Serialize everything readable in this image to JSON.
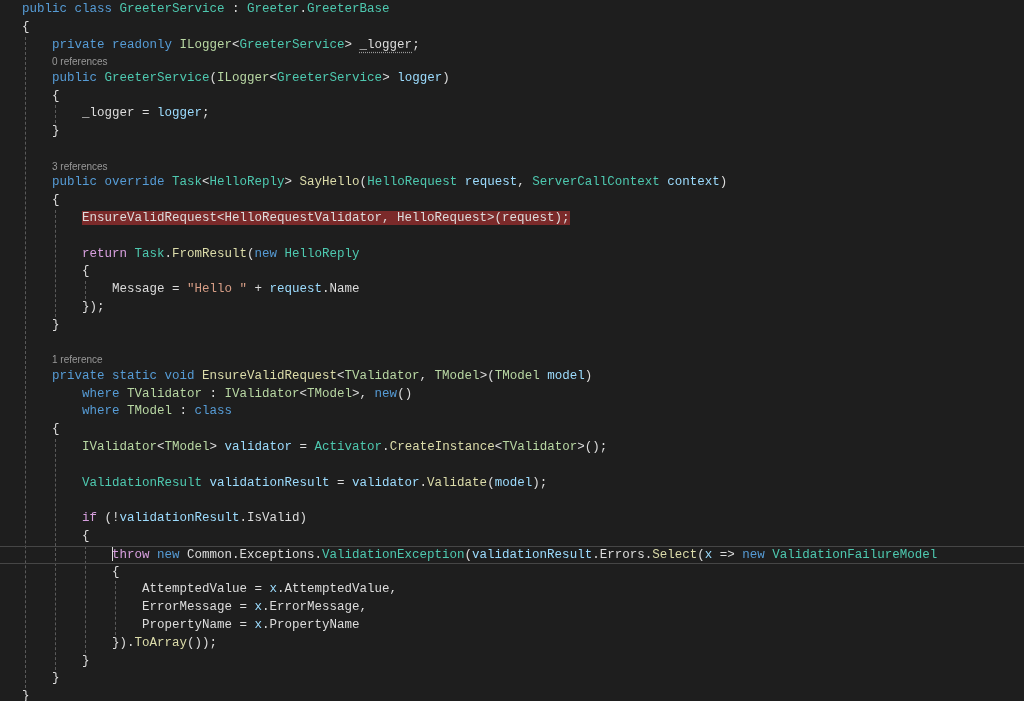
{
  "editor": {
    "lines": [
      {
        "kind": "code",
        "tokens": [
          {
            "text": "public class ",
            "kind": "kw"
          },
          {
            "text": "GreeterService",
            "kind": "type"
          },
          {
            "text": " : ",
            "kind": "plain"
          },
          {
            "text": "Greeter",
            "kind": "type"
          },
          {
            "text": ".",
            "kind": "plain"
          },
          {
            "text": "GreeterBase",
            "kind": "type"
          }
        ]
      },
      {
        "kind": "code",
        "tokens": [
          {
            "text": "{",
            "kind": "plain"
          }
        ],
        "guide": true,
        "children": [
          {
            "kind": "code",
            "tokens": [
              {
                "text": "private readonly ",
                "kind": "kw"
              },
              {
                "text": "ILogger",
                "kind": "iface"
              },
              {
                "text": "<",
                "kind": "plain"
              },
              {
                "text": "GreeterService",
                "kind": "type"
              },
              {
                "text": "> ",
                "kind": "plain"
              },
              {
                "text": "_logger",
                "kind": "hint"
              },
              {
                "text": ";",
                "kind": "plain"
              }
            ]
          },
          {
            "kind": "codelens",
            "text": "0 references"
          },
          {
            "kind": "code",
            "tokens": [
              {
                "text": "public ",
                "kind": "kw"
              },
              {
                "text": "GreeterService",
                "kind": "type"
              },
              {
                "text": "(",
                "kind": "plain"
              },
              {
                "text": "ILogger",
                "kind": "iface"
              },
              {
                "text": "<",
                "kind": "plain"
              },
              {
                "text": "GreeterService",
                "kind": "type"
              },
              {
                "text": "> ",
                "kind": "plain"
              },
              {
                "text": "logger",
                "kind": "var"
              },
              {
                "text": ")",
                "kind": "plain"
              }
            ]
          },
          {
            "kind": "code",
            "tokens": [
              {
                "text": "{",
                "kind": "plain"
              }
            ],
            "guide": true,
            "children": [
              {
                "kind": "code",
                "tokens": [
                  {
                    "text": "_logger = ",
                    "kind": "plain"
                  },
                  {
                    "text": "logger",
                    "kind": "var"
                  },
                  {
                    "text": ";",
                    "kind": "plain"
                  }
                ]
              }
            ]
          },
          {
            "kind": "code",
            "tokens": [
              {
                "text": "}",
                "kind": "plain"
              }
            ]
          },
          {
            "kind": "blank"
          },
          {
            "kind": "codelens",
            "text": "3 references"
          },
          {
            "kind": "code",
            "tokens": [
              {
                "text": "public override ",
                "kind": "kw"
              },
              {
                "text": "Task",
                "kind": "type"
              },
              {
                "text": "<",
                "kind": "plain"
              },
              {
                "text": "HelloReply",
                "kind": "type"
              },
              {
                "text": "> ",
                "kind": "plain"
              },
              {
                "text": "SayHello",
                "kind": "method"
              },
              {
                "text": "(",
                "kind": "plain"
              },
              {
                "text": "HelloRequest ",
                "kind": "type"
              },
              {
                "text": "request",
                "kind": "var"
              },
              {
                "text": ", ",
                "kind": "plain"
              },
              {
                "text": "ServerCallContext ",
                "kind": "type"
              },
              {
                "text": "context",
                "kind": "var"
              },
              {
                "text": ")",
                "kind": "plain"
              }
            ]
          },
          {
            "kind": "code",
            "tokens": [
              {
                "text": "{",
                "kind": "plain"
              }
            ],
            "guide": true,
            "children": [
              {
                "kind": "code",
                "error": true,
                "tokens": [
                  {
                    "text": "EnsureValidRequest<HelloRequestValidator, HelloRequest>(request);",
                    "kind": "plain"
                  }
                ]
              },
              {
                "kind": "blank"
              },
              {
                "kind": "code",
                "tokens": [
                  {
                    "text": "return ",
                    "kind": "ctl"
                  },
                  {
                    "text": "Task",
                    "kind": "type"
                  },
                  {
                    "text": ".",
                    "kind": "plain"
                  },
                  {
                    "text": "FromResult",
                    "kind": "method"
                  },
                  {
                    "text": "(",
                    "kind": "plain"
                  },
                  {
                    "text": "new ",
                    "kind": "kw"
                  },
                  {
                    "text": "HelloReply",
                    "kind": "type"
                  }
                ]
              },
              {
                "kind": "code",
                "tokens": [
                  {
                    "text": "{",
                    "kind": "plain"
                  }
                ],
                "guide": true,
                "children": [
                  {
                    "kind": "code",
                    "tokens": [
                      {
                        "text": "Message = ",
                        "kind": "plain"
                      },
                      {
                        "text": "\"Hello \"",
                        "kind": "str"
                      },
                      {
                        "text": " + ",
                        "kind": "plain"
                      },
                      {
                        "text": "request",
                        "kind": "var"
                      },
                      {
                        "text": ".Name",
                        "kind": "plain"
                      }
                    ]
                  }
                ]
              },
              {
                "kind": "code",
                "tokens": [
                  {
                    "text": "});",
                    "kind": "plain"
                  }
                ]
              }
            ]
          },
          {
            "kind": "code",
            "tokens": [
              {
                "text": "}",
                "kind": "plain"
              }
            ]
          },
          {
            "kind": "blank"
          },
          {
            "kind": "codelens",
            "text": "1 reference"
          },
          {
            "kind": "code",
            "tokens": [
              {
                "text": "private static void ",
                "kind": "kw"
              },
              {
                "text": "EnsureValidRequest",
                "kind": "method"
              },
              {
                "text": "<",
                "kind": "plain"
              },
              {
                "text": "TValidator",
                "kind": "iface"
              },
              {
                "text": ", ",
                "kind": "plain"
              },
              {
                "text": "TModel",
                "kind": "iface"
              },
              {
                "text": ">(",
                "kind": "plain"
              },
              {
                "text": "TModel ",
                "kind": "iface"
              },
              {
                "text": "model",
                "kind": "var"
              },
              {
                "text": ")",
                "kind": "plain"
              }
            ],
            "guide": false,
            "children": [
              {
                "kind": "code",
                "tokens": [
                  {
                    "text": "where ",
                    "kind": "kw"
                  },
                  {
                    "text": "TValidator",
                    "kind": "iface"
                  },
                  {
                    "text": " : ",
                    "kind": "plain"
                  },
                  {
                    "text": "IValidator",
                    "kind": "iface"
                  },
                  {
                    "text": "<",
                    "kind": "plain"
                  },
                  {
                    "text": "TModel",
                    "kind": "iface"
                  },
                  {
                    "text": ">, ",
                    "kind": "plain"
                  },
                  {
                    "text": "new",
                    "kind": "kw"
                  },
                  {
                    "text": "()",
                    "kind": "plain"
                  }
                ]
              },
              {
                "kind": "code",
                "tokens": [
                  {
                    "text": "where ",
                    "kind": "kw"
                  },
                  {
                    "text": "TModel",
                    "kind": "iface"
                  },
                  {
                    "text": " : ",
                    "kind": "plain"
                  },
                  {
                    "text": "class",
                    "kind": "kw"
                  }
                ]
              }
            ]
          },
          {
            "kind": "code",
            "tokens": [
              {
                "text": "{",
                "kind": "plain"
              }
            ],
            "guide": true,
            "children": [
              {
                "kind": "code",
                "tokens": [
                  {
                    "text": "IValidator",
                    "kind": "iface"
                  },
                  {
                    "text": "<",
                    "kind": "plain"
                  },
                  {
                    "text": "TModel",
                    "kind": "iface"
                  },
                  {
                    "text": "> ",
                    "kind": "plain"
                  },
                  {
                    "text": "validator",
                    "kind": "var"
                  },
                  {
                    "text": " = ",
                    "kind": "plain"
                  },
                  {
                    "text": "Activator",
                    "kind": "type"
                  },
                  {
                    "text": ".",
                    "kind": "plain"
                  },
                  {
                    "text": "CreateInstance",
                    "kind": "method"
                  },
                  {
                    "text": "<",
                    "kind": "plain"
                  },
                  {
                    "text": "TValidator",
                    "kind": "iface"
                  },
                  {
                    "text": ">();",
                    "kind": "plain"
                  }
                ]
              },
              {
                "kind": "blank"
              },
              {
                "kind": "code",
                "tokens": [
                  {
                    "text": "ValidationResult ",
                    "kind": "type"
                  },
                  {
                    "text": "validationResult",
                    "kind": "var"
                  },
                  {
                    "text": " = ",
                    "kind": "plain"
                  },
                  {
                    "text": "validator",
                    "kind": "var"
                  },
                  {
                    "text": ".",
                    "kind": "plain"
                  },
                  {
                    "text": "Validate",
                    "kind": "method"
                  },
                  {
                    "text": "(",
                    "kind": "plain"
                  },
                  {
                    "text": "model",
                    "kind": "var"
                  },
                  {
                    "text": ");",
                    "kind": "plain"
                  }
                ]
              },
              {
                "kind": "blank"
              },
              {
                "kind": "code",
                "tokens": [
                  {
                    "text": "if ",
                    "kind": "ctl"
                  },
                  {
                    "text": "(!",
                    "kind": "plain"
                  },
                  {
                    "text": "validationResult",
                    "kind": "var"
                  },
                  {
                    "text": ".IsValid)",
                    "kind": "plain"
                  }
                ]
              },
              {
                "kind": "code",
                "tokens": [
                  {
                    "text": "{",
                    "kind": "plain"
                  }
                ],
                "guide": true,
                "children": [
                  {
                    "kind": "code",
                    "current": true,
                    "tokens": [
                      {
                        "text": "throw ",
                        "kind": "ctl"
                      },
                      {
                        "text": "new ",
                        "kind": "kw"
                      },
                      {
                        "text": "Common.Exceptions.",
                        "kind": "plain"
                      },
                      {
                        "text": "ValidationException",
                        "kind": "type"
                      },
                      {
                        "text": "(",
                        "kind": "plain"
                      },
                      {
                        "text": "validationResult",
                        "kind": "var"
                      },
                      {
                        "text": ".Errors.",
                        "kind": "plain"
                      },
                      {
                        "text": "Select",
                        "kind": "method"
                      },
                      {
                        "text": "(",
                        "kind": "plain"
                      },
                      {
                        "text": "x",
                        "kind": "var"
                      },
                      {
                        "text": " => ",
                        "kind": "plain"
                      },
                      {
                        "text": "new ",
                        "kind": "kw"
                      },
                      {
                        "text": "ValidationFailureModel",
                        "kind": "type"
                      }
                    ]
                  },
                  {
                    "kind": "code",
                    "tokens": [
                      {
                        "text": "{",
                        "kind": "plain"
                      }
                    ],
                    "guide": true,
                    "children": [
                      {
                        "kind": "code",
                        "tokens": [
                          {
                            "text": "AttemptedValue = ",
                            "kind": "plain"
                          },
                          {
                            "text": "x",
                            "kind": "var"
                          },
                          {
                            "text": ".AttemptedValue,",
                            "kind": "plain"
                          }
                        ]
                      },
                      {
                        "kind": "code",
                        "tokens": [
                          {
                            "text": "ErrorMessage = ",
                            "kind": "plain"
                          },
                          {
                            "text": "x",
                            "kind": "var"
                          },
                          {
                            "text": ".ErrorMessage,",
                            "kind": "plain"
                          }
                        ]
                      },
                      {
                        "kind": "code",
                        "tokens": [
                          {
                            "text": "PropertyName = ",
                            "kind": "plain"
                          },
                          {
                            "text": "x",
                            "kind": "var"
                          },
                          {
                            "text": ".PropertyName",
                            "kind": "plain"
                          }
                        ]
                      }
                    ]
                  },
                  {
                    "kind": "code",
                    "tokens": [
                      {
                        "text": "}).",
                        "kind": "plain"
                      },
                      {
                        "text": "ToArray",
                        "kind": "method"
                      },
                      {
                        "text": "());",
                        "kind": "plain"
                      }
                    ]
                  }
                ]
              },
              {
                "kind": "code",
                "tokens": [
                  {
                    "text": "}",
                    "kind": "plain"
                  }
                ]
              }
            ]
          },
          {
            "kind": "code",
            "tokens": [
              {
                "text": "}",
                "kind": "plain"
              }
            ]
          }
        ]
      },
      {
        "kind": "code",
        "tokens": [
          {
            "text": "}",
            "kind": "plain"
          }
        ]
      }
    ]
  }
}
